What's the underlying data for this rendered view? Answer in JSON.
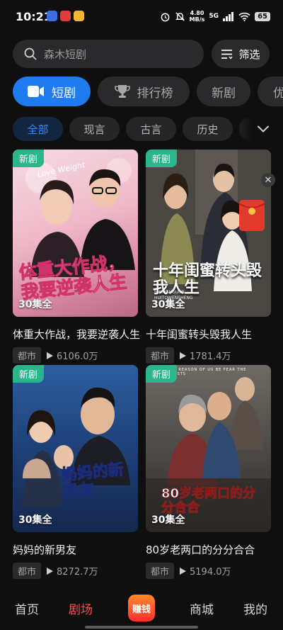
{
  "status_bar": {
    "time": "10:21",
    "speed_value": "4.80",
    "speed_unit": "MB/s",
    "network": "5G",
    "battery": "65"
  },
  "search": {
    "placeholder": "森木短剧",
    "icon": "search-icon"
  },
  "filter": {
    "label": "筛选",
    "icon": "filter-icon"
  },
  "main_tabs": [
    {
      "label": "短剧",
      "icon": "video-camera-icon",
      "active": true
    },
    {
      "label": "排行榜",
      "icon": "trophy-icon",
      "active": false
    },
    {
      "label": "新剧",
      "active": false
    },
    {
      "label": "优",
      "active": false
    }
  ],
  "genre_chips": [
    {
      "label": "全部",
      "active": true
    },
    {
      "label": "现言",
      "active": false
    },
    {
      "label": "古言",
      "active": false
    },
    {
      "label": "历史",
      "active": false
    }
  ],
  "cards": [
    {
      "badge": "新剧",
      "poster_title": "体重大作战，我要逆袭人生",
      "poster_top_text": "Love Weight",
      "episodes": "30集全",
      "title": "体重大作战，我要逆袭人生",
      "tag": "都市",
      "plays": "6106.0万"
    },
    {
      "badge": "新剧",
      "poster_title": "十年闺蜜转头毁我人生",
      "poster_sub": "SHINIANGUIMI HUITOWENSHENG",
      "episodes": "30集全",
      "title": "十年闺蜜转头毁我人生",
      "tag": "都市",
      "plays": "1781.4万"
    },
    {
      "badge": "新剧",
      "poster_title": "妈妈的新男友",
      "episodes": "30集全",
      "title": "妈妈的新男友",
      "tag": "都市",
      "plays": "8272.7万"
    },
    {
      "badge": "新剧",
      "poster_title": "80岁老两口的分分合合",
      "poster_top_text": "ONE REASON OF US BE FEAR THE GHOSTS",
      "episodes": "30集全",
      "title": "80岁老两口的分分合合",
      "tag": "都市",
      "plays": "5194.0万"
    }
  ],
  "bottom_nav": {
    "home": "首页",
    "theater": "剧场",
    "earn": "赚钱",
    "mall": "商城",
    "mine": "我的"
  },
  "colors": {
    "accent": "#1f7bf0",
    "badge": "#2bb58b",
    "nav_active": "#ff4a4a"
  }
}
